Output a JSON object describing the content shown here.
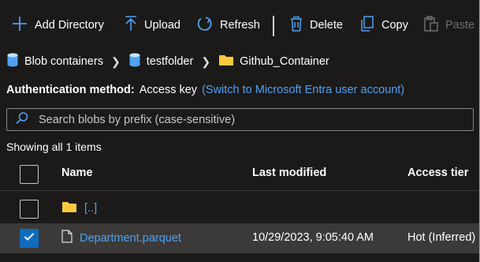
{
  "toolbar": {
    "add_directory": "Add Directory",
    "upload": "Upload",
    "refresh": "Refresh",
    "delete": "Delete",
    "copy": "Copy",
    "paste": "Paste"
  },
  "breadcrumb": {
    "items": [
      "Blob containers",
      "testfolder",
      "Github_Container"
    ]
  },
  "auth": {
    "label": "Authentication method:",
    "value": "Access key",
    "switch_link": "(Switch to Microsoft Entra user account)"
  },
  "search": {
    "placeholder": "Search blobs by prefix (case-sensitive)",
    "value": ""
  },
  "status": {
    "count_text": "Showing all 1 items"
  },
  "table": {
    "columns": [
      "Name",
      "Last modified",
      "Access tier"
    ],
    "rows": [
      {
        "name": "[..]",
        "type": "folder",
        "last_modified": "",
        "access_tier": "",
        "selected": false
      },
      {
        "name": "Department.parquet",
        "type": "file",
        "last_modified": "10/29/2023, 9:05:40 AM",
        "access_tier": "Hot (Inferred)",
        "selected": true
      }
    ]
  },
  "colors": {
    "background": "#1b1a19",
    "accent_blue": "#4ea1f3",
    "toolbar_icon_blue": "#4ea1f3",
    "folder_yellow": "#ffc83d",
    "checkbox_checked": "#0f6cbd",
    "selected_row": "#3b3a39"
  },
  "icons": {
    "add_directory": "plus-icon",
    "upload": "upload-icon",
    "refresh": "refresh-icon",
    "delete": "trash-icon",
    "copy": "copy-icon",
    "paste": "paste-icon",
    "container": "blob-container-icon",
    "folder": "folder-icon",
    "file": "file-icon",
    "search": "search-icon"
  }
}
